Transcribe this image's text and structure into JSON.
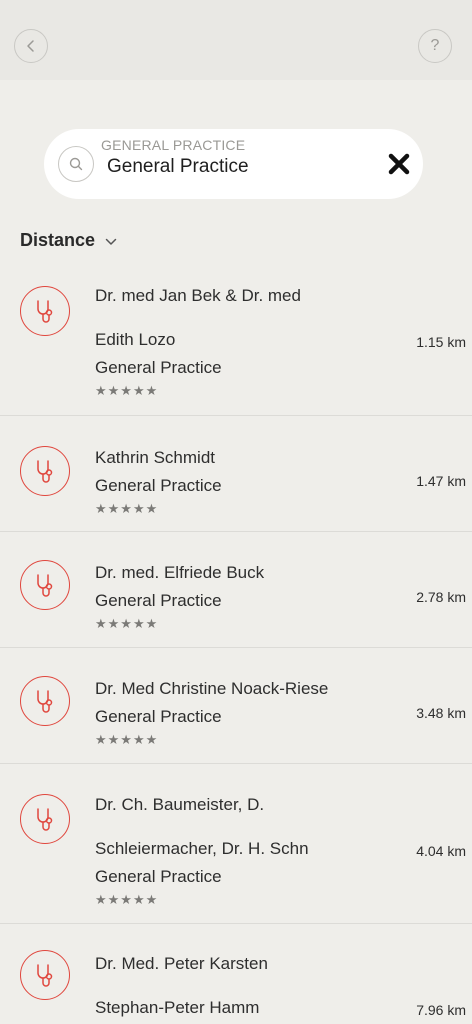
{
  "header": {
    "back_icon": "chevron-left-icon",
    "help_label": "?"
  },
  "search": {
    "caption": "GENERAL PRACTICE",
    "value": "General Practice",
    "icon": "search-icon",
    "clear_icon": "close-icon"
  },
  "sort": {
    "label": "Distance",
    "icon": "chevron-down-icon"
  },
  "results": [
    {
      "name_line1": "Dr. med Jan Bek & Dr. med",
      "name_line2": "Edith Lozo",
      "specialty": "General Practice",
      "rating": "★★★★★",
      "distance": "1.15 km"
    },
    {
      "name_line1": "Kathrin Schmidt",
      "specialty": "General Practice",
      "rating": "★★★★★",
      "distance": "1.47 km"
    },
    {
      "name_line1": "Dr. med. Elfriede Buck",
      "specialty": "General Practice",
      "rating": "★★★★★",
      "distance": "2.78 km"
    },
    {
      "name_line1": "Dr. Med Christine Noack-Riese",
      "specialty": "General Practice",
      "rating": "★★★★★",
      "distance": "3.48 km"
    },
    {
      "name_line1": "Dr. Ch. Baumeister, D.",
      "name_line2": "Schleiermacher, Dr. H. Schn",
      "specialty": "General Practice",
      "rating": "★★★★★",
      "distance": "4.04 km"
    },
    {
      "name_line1": "Dr. Med. Peter Karsten",
      "name_line2": "Stephan-Peter Hamm",
      "distance": "7.96 km"
    }
  ],
  "colors": {
    "accent": "#e0473e",
    "background": "#efeeea"
  }
}
